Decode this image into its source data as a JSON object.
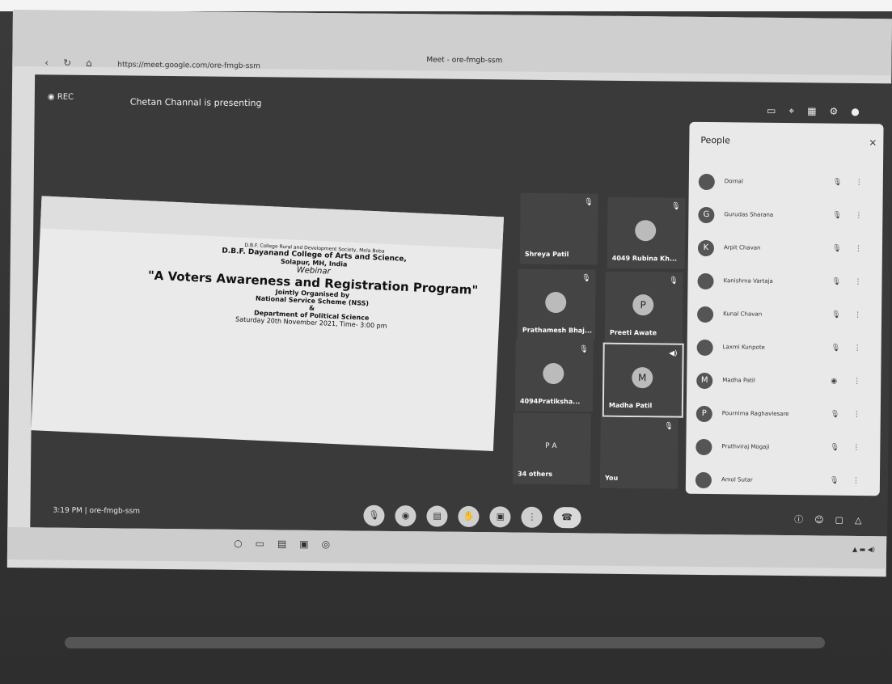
{
  "browser": {
    "tab_title": "Meet - ore-fmgb-ssm",
    "url": "https://meet.google.com/ore-fmgb-ssm"
  },
  "meet": {
    "rec_label": "REC",
    "presenting_text": "Chetan Channal is presenting",
    "time": "3:19 PM",
    "meeting_code": "ore-fmgb-ssm"
  },
  "slide": {
    "line1": "D.B.F. College Rural and Development Society, Mela Boba",
    "line2": "D.B.F. Dayanand College of Arts and Science,",
    "line3": "Solapur, MH, India",
    "line4": "Webinar",
    "title": "\"A Voters Awareness and Registration Program\"",
    "line5": "Jointly Organised by",
    "line6": "National Service Scheme (NSS)",
    "line7": "&",
    "line8": "Department of Political Science",
    "date": "Saturday 20th November 2021, Time- 3:00 pm"
  },
  "tiles": [
    {
      "name": "Shreya Patil",
      "initial": ""
    },
    {
      "name": "4049 Rubina Kh...",
      "initial": ""
    },
    {
      "name": "Prathamesh Bhaj...",
      "initial": ""
    },
    {
      "name": "Preeti Awate",
      "initial": "P"
    },
    {
      "name": "4094Pratiksha...",
      "initial": ""
    },
    {
      "name": "Madha Patil",
      "initial": "M"
    },
    {
      "name": "34 others",
      "initial": "P A"
    },
    {
      "name": "You",
      "initial": ""
    }
  ],
  "people": {
    "header": "People",
    "close": "×",
    "list": [
      {
        "name": "Dornal",
        "initial": ""
      },
      {
        "name": "Gurudas Sharana",
        "initial": "G"
      },
      {
        "name": "Arpit Chavan",
        "initial": "K"
      },
      {
        "name": "Kanishma Vartaja",
        "initial": ""
      },
      {
        "name": "Kunal Chavan",
        "initial": ""
      },
      {
        "name": "Laxmi Kunpote",
        "initial": ""
      },
      {
        "name": "Madha Patil",
        "initial": "M"
      },
      {
        "name": "Pournima Raghavlesare",
        "initial": "P"
      },
      {
        "name": "Pruthviraj Mogaji",
        "initial": ""
      },
      {
        "name": "Amol Sutar",
        "initial": ""
      }
    ]
  }
}
